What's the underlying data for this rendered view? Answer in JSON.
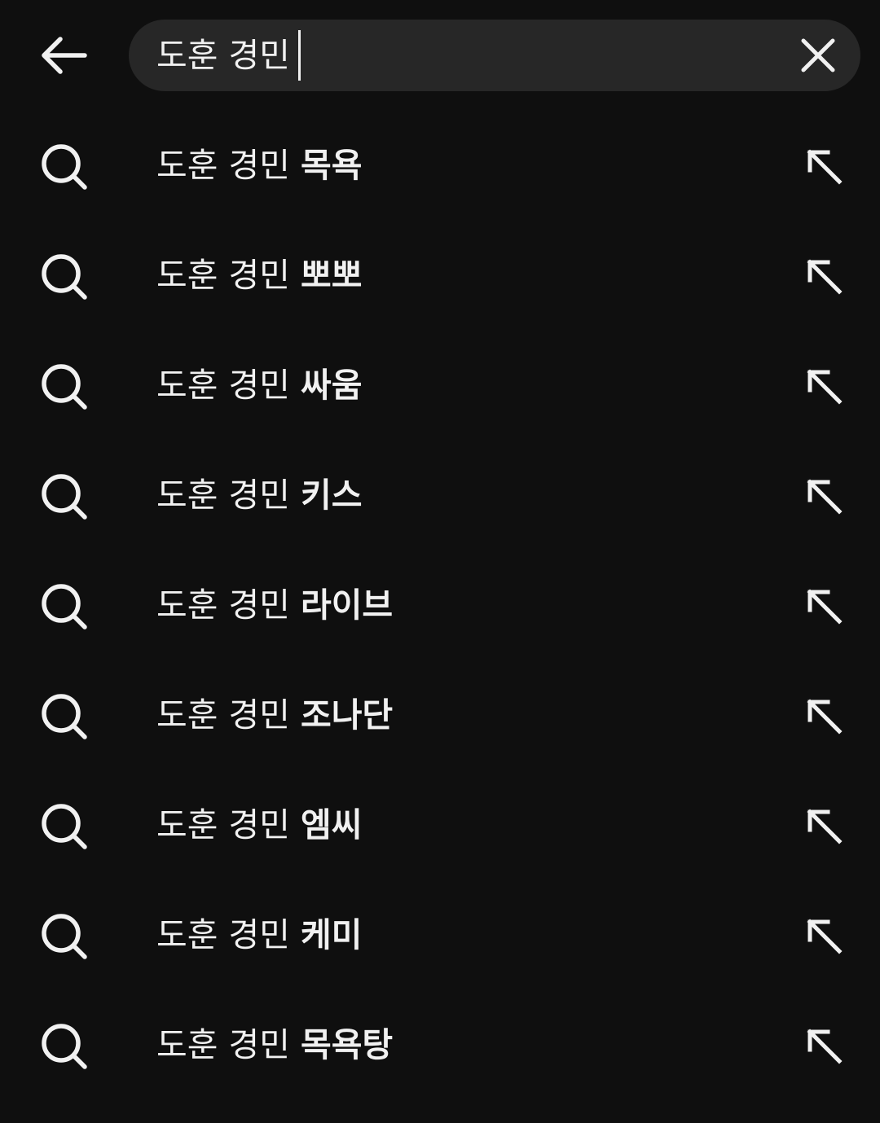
{
  "search": {
    "query": "도훈 경민",
    "back_icon": "arrow-left-icon",
    "clear_icon": "close-icon"
  },
  "suggestions": [
    {
      "query": "도훈 경민",
      "completion": "목욕"
    },
    {
      "query": "도훈 경민",
      "completion": "뽀뽀"
    },
    {
      "query": "도훈 경민",
      "completion": "싸움"
    },
    {
      "query": "도훈 경민",
      "completion": "키스"
    },
    {
      "query": "도훈 경민",
      "completion": "라이브"
    },
    {
      "query": "도훈 경민",
      "completion": "조나단"
    },
    {
      "query": "도훈 경민",
      "completion": "엠씨"
    },
    {
      "query": "도훈 경민",
      "completion": "케미"
    },
    {
      "query": "도훈 경민",
      "completion": "목욕탕"
    }
  ],
  "icons": {
    "suggestion_icon": "search-icon",
    "fill_icon": "arrow-up-left-icon"
  },
  "colors": {
    "background": "#0f0f0f",
    "search_box": "#272727",
    "text": "#f1f1f1"
  }
}
